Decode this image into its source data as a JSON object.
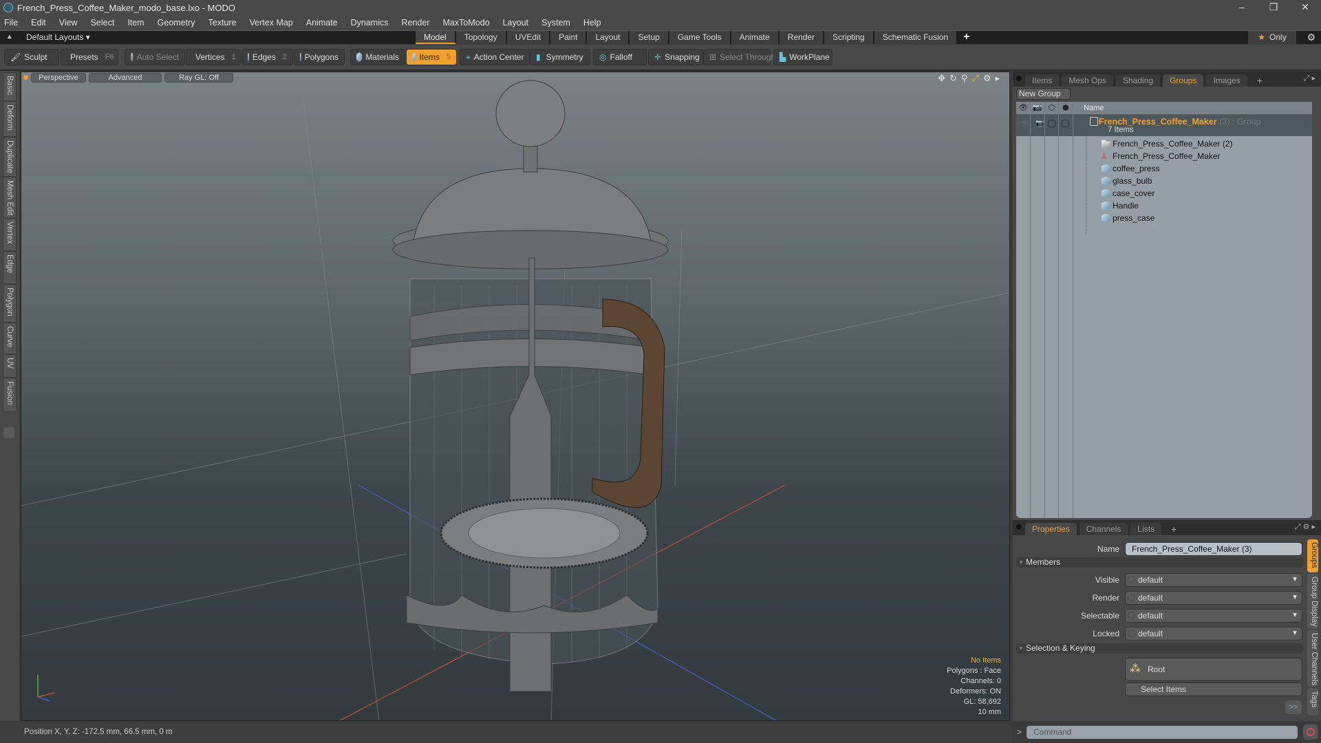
{
  "window": {
    "title": "French_Press_Coffee_Maker_modo_base.lxo - MODO",
    "minimize": "–",
    "maximize": "❐",
    "close": "✕"
  },
  "menu": [
    "File",
    "Edit",
    "View",
    "Select",
    "Item",
    "Geometry",
    "Texture",
    "Vertex Map",
    "Animate",
    "Dynamics",
    "Render",
    "MaxToModo",
    "Layout",
    "System",
    "Help"
  ],
  "layoutbar": {
    "default_layouts": "Default Layouts ▾",
    "tabs": [
      "Model",
      "Topology",
      "UVEdit",
      "Paint",
      "Layout",
      "Setup",
      "Game Tools",
      "Animate",
      "Render",
      "Scripting",
      "Schematic Fusion"
    ],
    "active_tab": "Model",
    "add": "+",
    "only": "Only",
    "only_star": "★",
    "gear": "⚙"
  },
  "toolbar": {
    "sculpt": "Sculpt",
    "presets": "Presets",
    "presets_key": "F6",
    "auto_select": "Auto Select",
    "vertices": "Vertices",
    "vertices_count": "1",
    "edges": "Edges",
    "edges_count": "2",
    "polygons": "Polygons",
    "materials": "Materials",
    "items": "Items",
    "items_count": "5",
    "action_center": "Action Center",
    "symmetry": "Symmetry",
    "falloff": "Falloff",
    "snapping": "Snapping",
    "select_through": "Select Through",
    "workplane": "WorkPlane"
  },
  "left_tabs": [
    "Basic",
    "Deform",
    "Duplicate",
    "Mesh Edit",
    "Vertex",
    "Edge",
    "Polygon",
    "Curve",
    "UV",
    "Fusion"
  ],
  "viewport": {
    "perspective": "Perspective",
    "advanced": "Advanced",
    "raygl": "Ray GL: Off",
    "info": {
      "selection": "No Items",
      "polygons": "Polygons : Face",
      "channels": "Channels: 0",
      "deformers": "Deformers: ON",
      "gl": "GL: 58,692",
      "scale": "10 mm"
    }
  },
  "status": {
    "position": "Position X, Y, Z:  -172.5 mm, 66.5 mm, 0 m"
  },
  "groups_panel": {
    "tabs": [
      "Items",
      "Mesh Ops",
      "Shading",
      "Groups",
      "Images"
    ],
    "active_tab": "Groups",
    "add": "+",
    "new_group": "New Group",
    "name_header": "Name",
    "group": {
      "name": "French_Press_Coffee_Maker",
      "count": "(3)",
      "type": ": Group",
      "sub": "7 Items"
    },
    "items": [
      {
        "name": "French_Press_Coffee_Maker (2)",
        "icon": "folder-icon"
      },
      {
        "name": "French_Press_Coffee_Maker",
        "icon": "locator-icon"
      },
      {
        "name": "coffee_press",
        "icon": "mesh-icon"
      },
      {
        "name": "glass_bulb",
        "icon": "mesh-icon"
      },
      {
        "name": "case_cover",
        "icon": "mesh-icon"
      },
      {
        "name": "Handle",
        "icon": "mesh-icon"
      },
      {
        "name": "press_case",
        "icon": "mesh-icon"
      }
    ]
  },
  "properties_panel": {
    "tabs": [
      "Properties",
      "Channels",
      "Lists"
    ],
    "active_tab": "Properties",
    "add": "+",
    "name_label": "Name",
    "name_value": "French_Press_Coffee_Maker (3)",
    "members_section": "Members",
    "fields": [
      {
        "label": "Visible",
        "value": "default"
      },
      {
        "label": "Render",
        "value": "default"
      },
      {
        "label": "Selectable",
        "value": "default"
      },
      {
        "label": "Locked",
        "value": "default"
      }
    ],
    "selection_section": "Selection & Keying",
    "root_button": "Root",
    "select_items_button": "Select Items",
    "more_button": ">>",
    "side_tabs": [
      "Groups",
      "Group Display",
      "User Channels",
      "Tags"
    ],
    "active_side_tab": "Groups"
  },
  "command": {
    "prompt": ">",
    "placeholder": "Command"
  }
}
